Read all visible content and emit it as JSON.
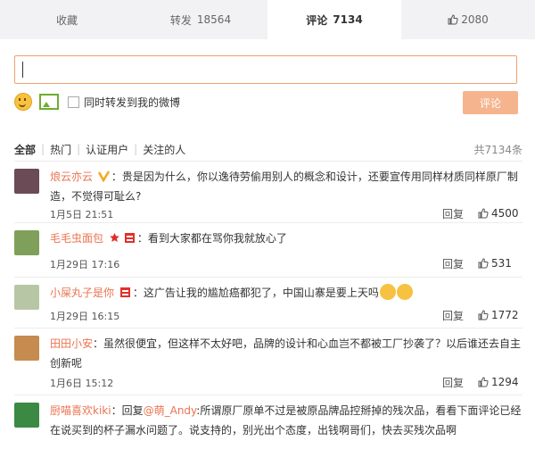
{
  "tabs": [
    {
      "label": "收藏",
      "count": ""
    },
    {
      "label": "转发",
      "count": "18564"
    },
    {
      "label": "评论",
      "count": "7134"
    },
    {
      "label": "",
      "count": "2080"
    }
  ],
  "composer": {
    "share_label": "同时转发到我的微博",
    "submit_label": "评论"
  },
  "filters": [
    "全部",
    "热门",
    "认证用户",
    "关注的人"
  ],
  "total": "共7134条",
  "reply_label": "回复",
  "comments": [
    {
      "name": "烺云亦云",
      "text": "贵是因为什么，你以逸待劳偷用别人的概念和设计，还要宣传用同样材质同样原厂制造，不觉得可耻么?",
      "time": "1月5日 21:51",
      "likes": "4500"
    },
    {
      "name": "毛毛虫面包",
      "text": "看到大家都在骂你我就放心了",
      "time": "1月29日 17:16",
      "likes": "531"
    },
    {
      "name": "小屎丸子是你",
      "text": "这广告让我的尴尬癌都犯了，中国山寨是要上天吗",
      "time": "1月29日 16:15",
      "likes": "1772"
    },
    {
      "name": "田田小安",
      "text": "虽然很便宜，但这样不太好吧，品牌的设计和心血岂不都被工厂抄袭了？以后谁还去自主创新呢",
      "time": "1月6日 15:12",
      "likes": "1294"
    },
    {
      "name": "厨喵喜欢kiki",
      "reply_prefix": "回复",
      "mention": "@萌_Andy",
      "text": "所谓原厂原单不过是被原品牌品控掰掉的残次品，看看下面评论已经在说买到的杯子漏水问题了。说支持的，别光出个态度，出钱啊哥们，快去买残次品啊"
    }
  ],
  "colors": {
    "accent": "#eb7350",
    "input_border": "#f0a070",
    "submit_bg": "#f6b48e",
    "tab_bar": "#f2f2f5"
  }
}
